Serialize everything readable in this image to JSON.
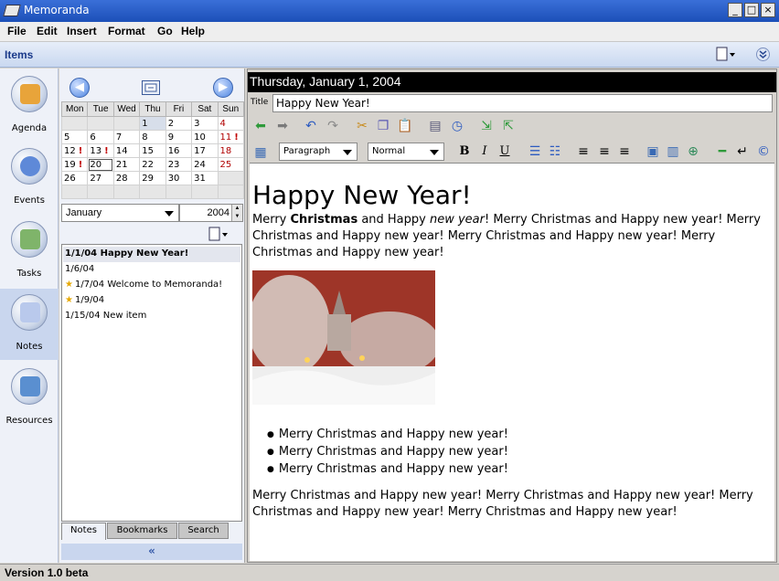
{
  "window": {
    "title": "Memoranda"
  },
  "menu": [
    "File",
    "Edit",
    "Insert",
    "Format",
    "Go",
    "Help"
  ],
  "itemsbar": {
    "label": "Items"
  },
  "sidebar": [
    {
      "label": "Agenda",
      "icon": "agenda-icon"
    },
    {
      "label": "Events",
      "icon": "events-icon"
    },
    {
      "label": "Tasks",
      "icon": "tasks-icon"
    },
    {
      "label": "Notes",
      "icon": "notes-icon",
      "active": true
    },
    {
      "label": "Resources",
      "icon": "resources-icon"
    }
  ],
  "calendar": {
    "weekdays": [
      "Mon",
      "Tue",
      "Wed",
      "Thu",
      "Fri",
      "Sat",
      "Sun"
    ],
    "weeks": [
      [
        "",
        "",
        "",
        "1",
        "2",
        "3",
        "4"
      ],
      [
        "5",
        "6",
        "7",
        "8",
        "9",
        "10",
        "11"
      ],
      [
        "12",
        "13",
        "14",
        "15",
        "16",
        "17",
        "18"
      ],
      [
        "19",
        "20",
        "21",
        "22",
        "23",
        "24",
        "25"
      ],
      [
        "26",
        "27",
        "28",
        "29",
        "30",
        "31",
        ""
      ],
      [
        "",
        "",
        "",
        "",
        "",
        "",
        ""
      ]
    ],
    "marked_days": [
      "11",
      "12",
      "13",
      "19"
    ],
    "selected_day": "1",
    "today": "20",
    "month": "January",
    "year": "2004"
  },
  "notes": [
    {
      "label": "1/1/04 Happy New Year!",
      "selected": true,
      "starred": false
    },
    {
      "label": "1/6/04",
      "starred": false
    },
    {
      "label": "1/7/04 Welcome to Memoranda!",
      "starred": true
    },
    {
      "label": "1/9/04",
      "starred": true
    },
    {
      "label": "1/15/04 New item",
      "starred": false
    }
  ],
  "tabs": [
    "Notes",
    "Bookmarks",
    "Search"
  ],
  "editor": {
    "date_header": "Thursday, January 1, 2004",
    "title_label": "Title",
    "title_value": "Happy New Year!",
    "paragraph_style": "Paragraph",
    "font_style": "Normal",
    "bold_label": "B",
    "italic_label": "I",
    "underline_label": "U"
  },
  "document": {
    "heading": "Happy New Year!",
    "para1_a": "Merry ",
    "para1_bold": "Christmas",
    "para1_b": " and Happy ",
    "para1_italic": "new year",
    "para1_c": "! Merry Christmas and Happy new year! Merry Christmas and Happy new year! Merry Christmas and Happy new year! Merry Christmas and Happy new year!",
    "bullets": [
      "Merry Christmas and Happy new year!",
      "Merry Christmas and Happy new year!",
      "Merry Christmas and Happy new year!"
    ],
    "para2": "Merry Christmas and Happy new year! Merry Christmas and Happy new year! Merry Christmas and Happy new year! Merry Christmas and Happy new year!"
  },
  "status": {
    "text": "Version 1.0 beta"
  },
  "colors": {
    "titlebar": "#1c4fb8",
    "sidebar_active": "#c9d6ee",
    "sunday": "#b00000"
  }
}
